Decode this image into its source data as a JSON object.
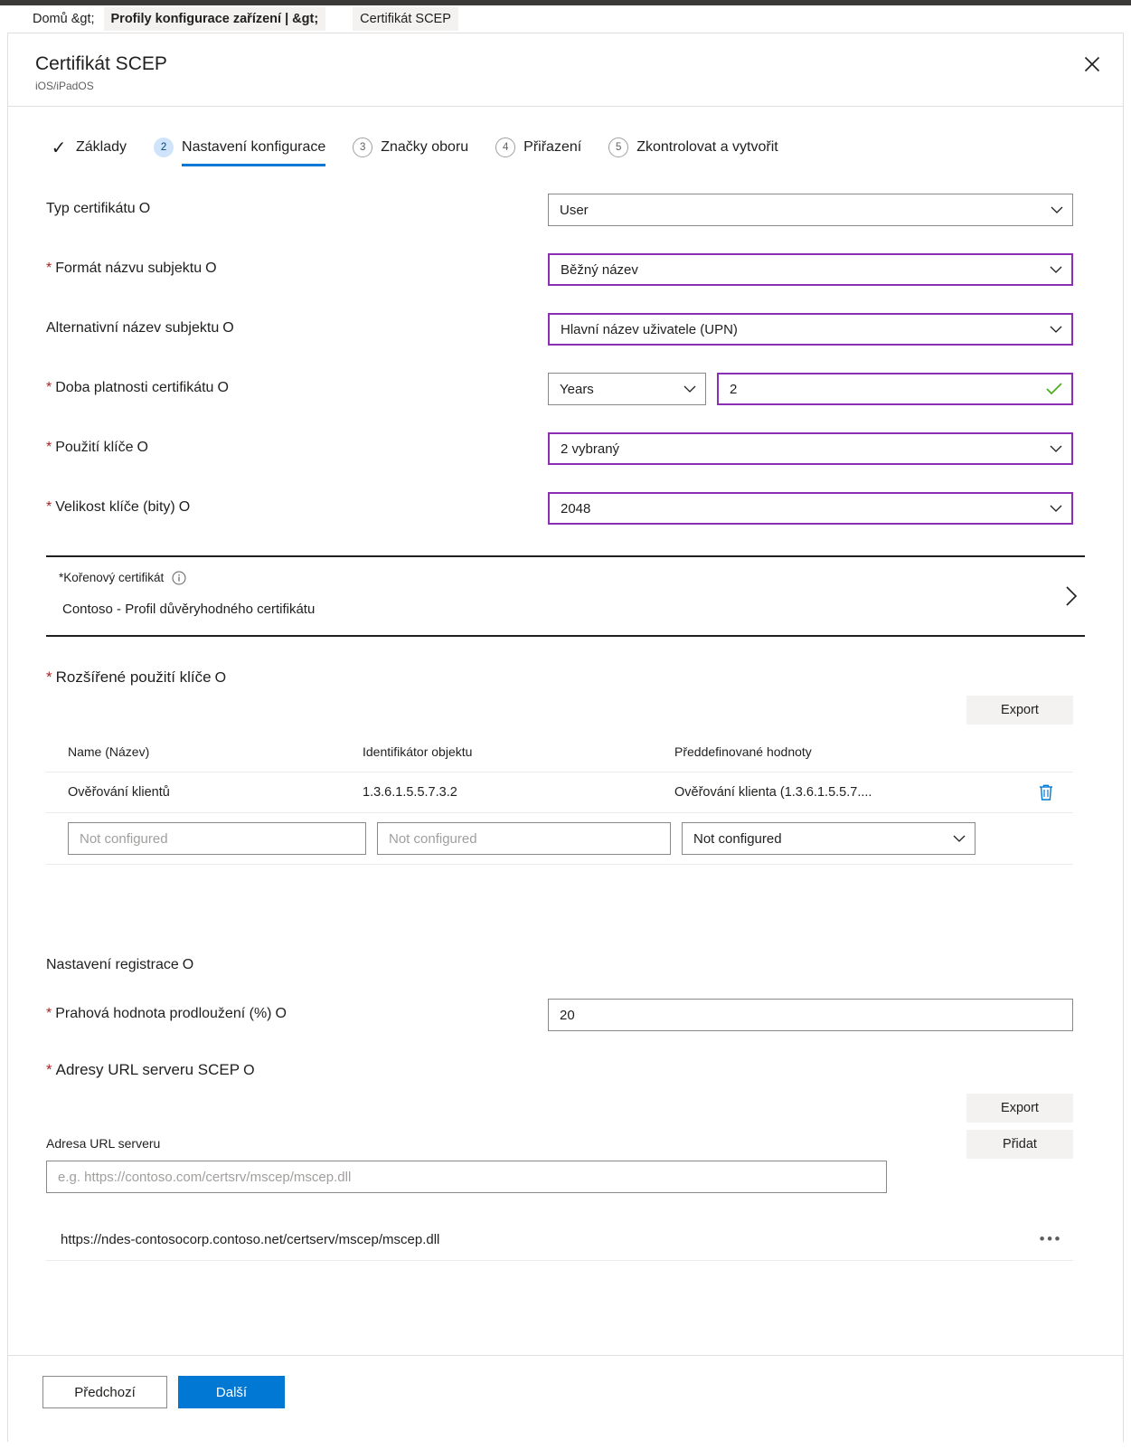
{
  "breadcrumb": {
    "items": [
      {
        "label": "Domů &gt;",
        "style": "plain"
      },
      {
        "label": "Profily konfigurace zařízení | &gt;",
        "style": "hl"
      },
      {
        "label": "Certifikát SCEP",
        "style": "hl2"
      }
    ]
  },
  "blade": {
    "title": "Certifikát SCEP",
    "subtitle": "iOS/iPadOS",
    "close_icon": "close-icon"
  },
  "steps": [
    {
      "marker": "✓",
      "state": "done",
      "label": "Základy"
    },
    {
      "marker": "2",
      "state": "current",
      "label": "Nastavení konfigurace"
    },
    {
      "marker": "3",
      "state": "todo",
      "label": "Značky oboru"
    },
    {
      "marker": "4",
      "state": "todo",
      "label": "Přiřazení"
    },
    {
      "marker": "5",
      "state": "todo",
      "label": "Zkontrolovat a vytvořit"
    }
  ],
  "form": {
    "cert_type": {
      "label": "Typ certifikátu",
      "info": "O",
      "value": "User",
      "required": false
    },
    "subject_name_format": {
      "label": "Formát názvu subjektu",
      "info": "O",
      "value": "Běžný název",
      "required": true
    },
    "subject_alt_name": {
      "label": "Alternativní název subjektu",
      "info": "O",
      "value": "Hlavní název uživatele (UPN)",
      "required": false
    },
    "validity_period": {
      "label": "Doba platnosti certifikátu",
      "info": "O",
      "unit": "Years",
      "amount": "2",
      "required": true
    },
    "key_usage": {
      "label": "Použití klíče",
      "info": "O",
      "value": "2 vybraný",
      "required": true
    },
    "key_size": {
      "label": "Velikost klíče (bity)",
      "info": "O",
      "value": "2048",
      "required": true
    }
  },
  "root_cert": {
    "label": "*Kořenový certifikát",
    "info_icon": "info-circle-icon",
    "value": "Contoso - Profil důvěryhodného certifikátu",
    "chevron_icon": "chevron-right-icon"
  },
  "eku": {
    "heading": "Rozšířené použití klíče",
    "heading_info": "O",
    "heading_required": true,
    "export_label": "Export",
    "columns": [
      "Name (Název)",
      "Identifikátor objektu",
      "Předdefinované hodnoty"
    ],
    "rows": [
      {
        "name": "Ověřování klientů",
        "oid": "1.3.6.1.5.5.7.3.2",
        "predefined": "Ověřování klienta (1.3.6.1.5.5.7....",
        "delete_icon": "trash-icon"
      }
    ],
    "new_row": {
      "name_placeholder": "Not configured",
      "oid_placeholder": "Not configured",
      "predefined_placeholder": "Not configured"
    }
  },
  "enrollment": {
    "heading": "Nastavení registrace",
    "heading_info": "O",
    "renewal_threshold": {
      "label": "Prahová hodnota prodloužení (%)",
      "info": "O",
      "value": "20",
      "required": true
    }
  },
  "scep_urls": {
    "heading": "Adresy URL serveru SCEP",
    "heading_info": "O",
    "heading_required": true,
    "export_label": "Export",
    "add_label": "Přidat",
    "url_field_label": "Adresa URL serveru",
    "url_placeholder": "e.g. https://contoso.com/certsrv/mscep/mscep.dll",
    "url_value": "",
    "items": [
      {
        "url": "https://ndes-contosocorp.contoso.net/certserv/mscep/mscep.dll",
        "menu_icon": "ellipsis-icon"
      }
    ]
  },
  "footer": {
    "previous_label": "Předchozí",
    "next_label": "Další"
  },
  "colors": {
    "accent": "#0078d4",
    "required": "#a4262c",
    "modified_border": "#8c2fb5",
    "valid_check": "#4caf1e",
    "neutral_border": "#8a8886",
    "flat_button_bg": "#f3f2f1"
  }
}
